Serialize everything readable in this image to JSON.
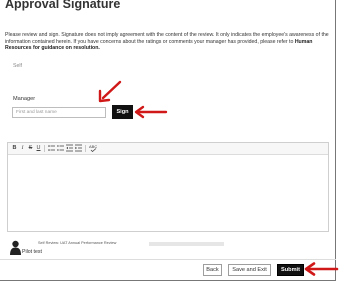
{
  "header": {
    "title": "Approval Signature"
  },
  "intro": {
    "text": "Please review and sign. Signature does not imply agreement with the content of the review. It only indicates the employee's awareness of the information contained herein. If you have concerns about the ratings or comments your manager has provided, please refer to ",
    "link_text": "Human Resources for guidance on resolution."
  },
  "self_label": "Self",
  "manager": {
    "label": "Manager",
    "placeholder": "First and last name",
    "sign_label": "Sign"
  },
  "editor": {
    "toolbar": [
      "bold",
      "italic",
      "strikethrough",
      "underline",
      "bulleted-list",
      "numbered-list",
      "outdent",
      "indent",
      "spellcheck"
    ]
  },
  "comment": {
    "meta": "Self    Review: UAT Annual Performance Review",
    "author": "Pilot test"
  },
  "actions": {
    "back_label": "Back",
    "save_exit_label": "Save and Exit",
    "submit_label": "Submit"
  },
  "colors": {
    "annotation_arrow": "#d01818",
    "primary_button": "#111111"
  }
}
